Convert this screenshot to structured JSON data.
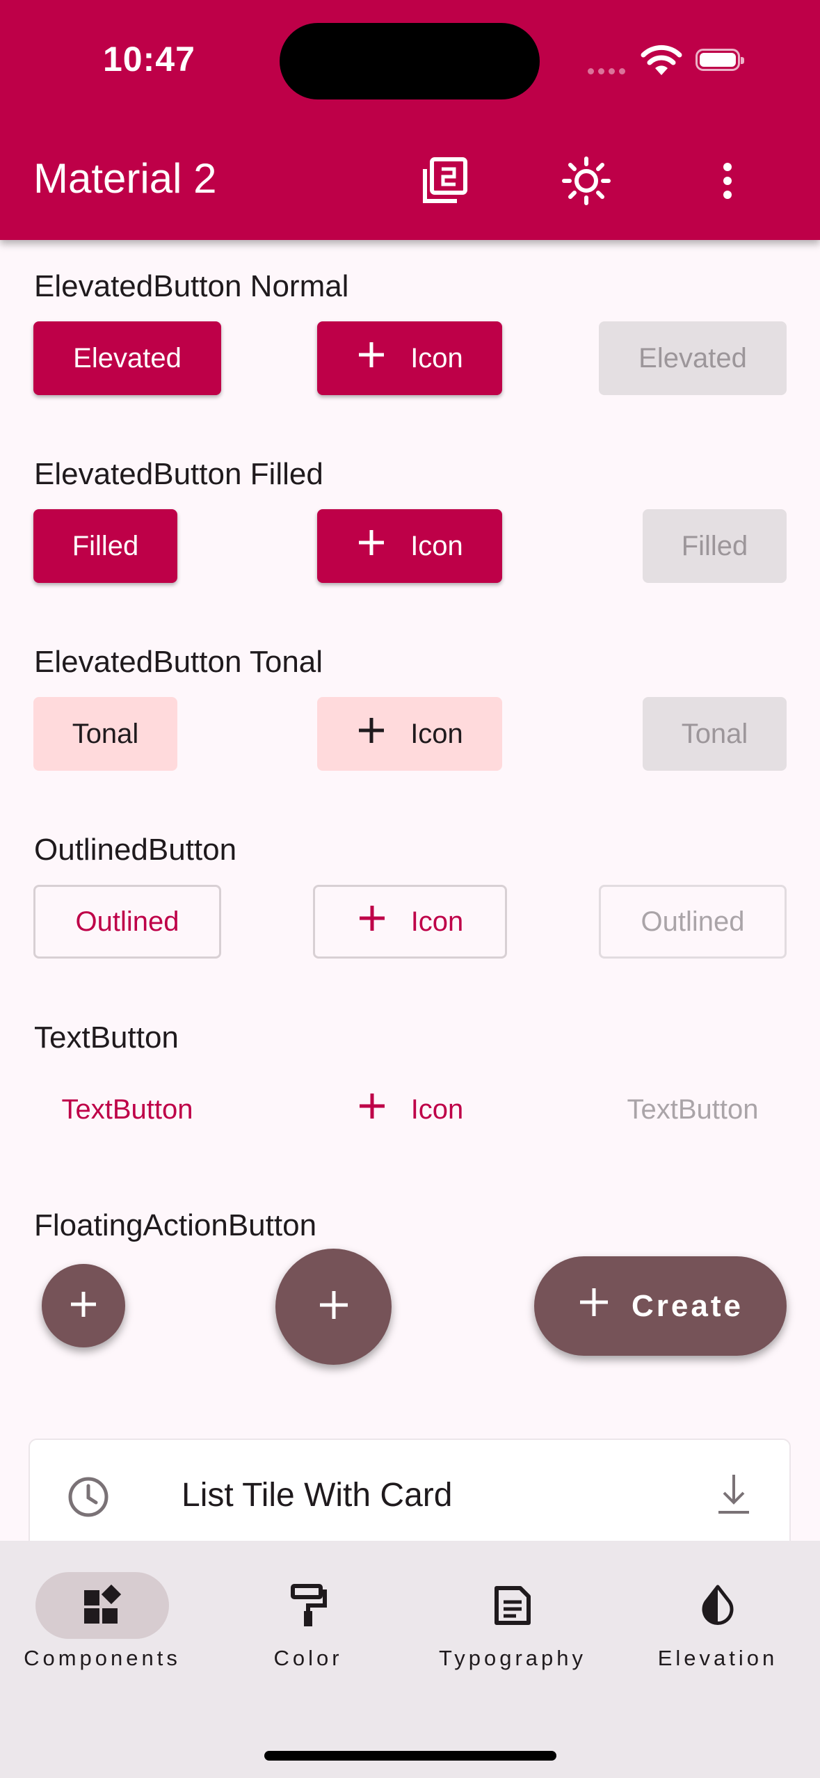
{
  "status_bar": {
    "time": "10:47"
  },
  "appbar": {
    "title": "Material 2",
    "icons": [
      "material-version-icon",
      "brightness-icon",
      "more-vert-icon"
    ]
  },
  "sections": {
    "elevated_normal": {
      "label": "ElevatedButton Normal",
      "btn1": "Elevated",
      "btn2": "Icon",
      "btn3": "Elevated"
    },
    "elevated_filled": {
      "label": "ElevatedButton Filled",
      "btn1": "Filled",
      "btn2": "Icon",
      "btn3": "Filled"
    },
    "elevated_tonal": {
      "label": "ElevatedButton Tonal",
      "btn1": "Tonal",
      "btn2": "Icon",
      "btn3": "Tonal"
    },
    "outlined": {
      "label": "OutlinedButton",
      "btn1": "Outlined",
      "btn2": "Icon",
      "btn3": "Outlined"
    },
    "text": {
      "label": "TextButton",
      "btn1": "TextButton",
      "btn2": "Icon",
      "btn3": "TextButton"
    },
    "fab": {
      "label": "FloatingActionButton",
      "extended_label": "Create"
    }
  },
  "card": {
    "title": "List Tile With Card",
    "leading_icon": "clock-icon",
    "trailing_icon": "download-icon"
  },
  "nav": [
    {
      "label": "Components",
      "icon": "widgets-icon",
      "active": true
    },
    {
      "label": "Color",
      "icon": "format-paint-icon",
      "active": false
    },
    {
      "label": "Typography",
      "icon": "article-icon",
      "active": false
    },
    {
      "label": "Elevation",
      "icon": "opacity-icon",
      "active": false
    }
  ],
  "colors": {
    "primary": "#be0048",
    "tonal": "#ffdadc",
    "fab": "#765358",
    "background": "#fef7fb",
    "nav_bar": "#ece7eb"
  }
}
